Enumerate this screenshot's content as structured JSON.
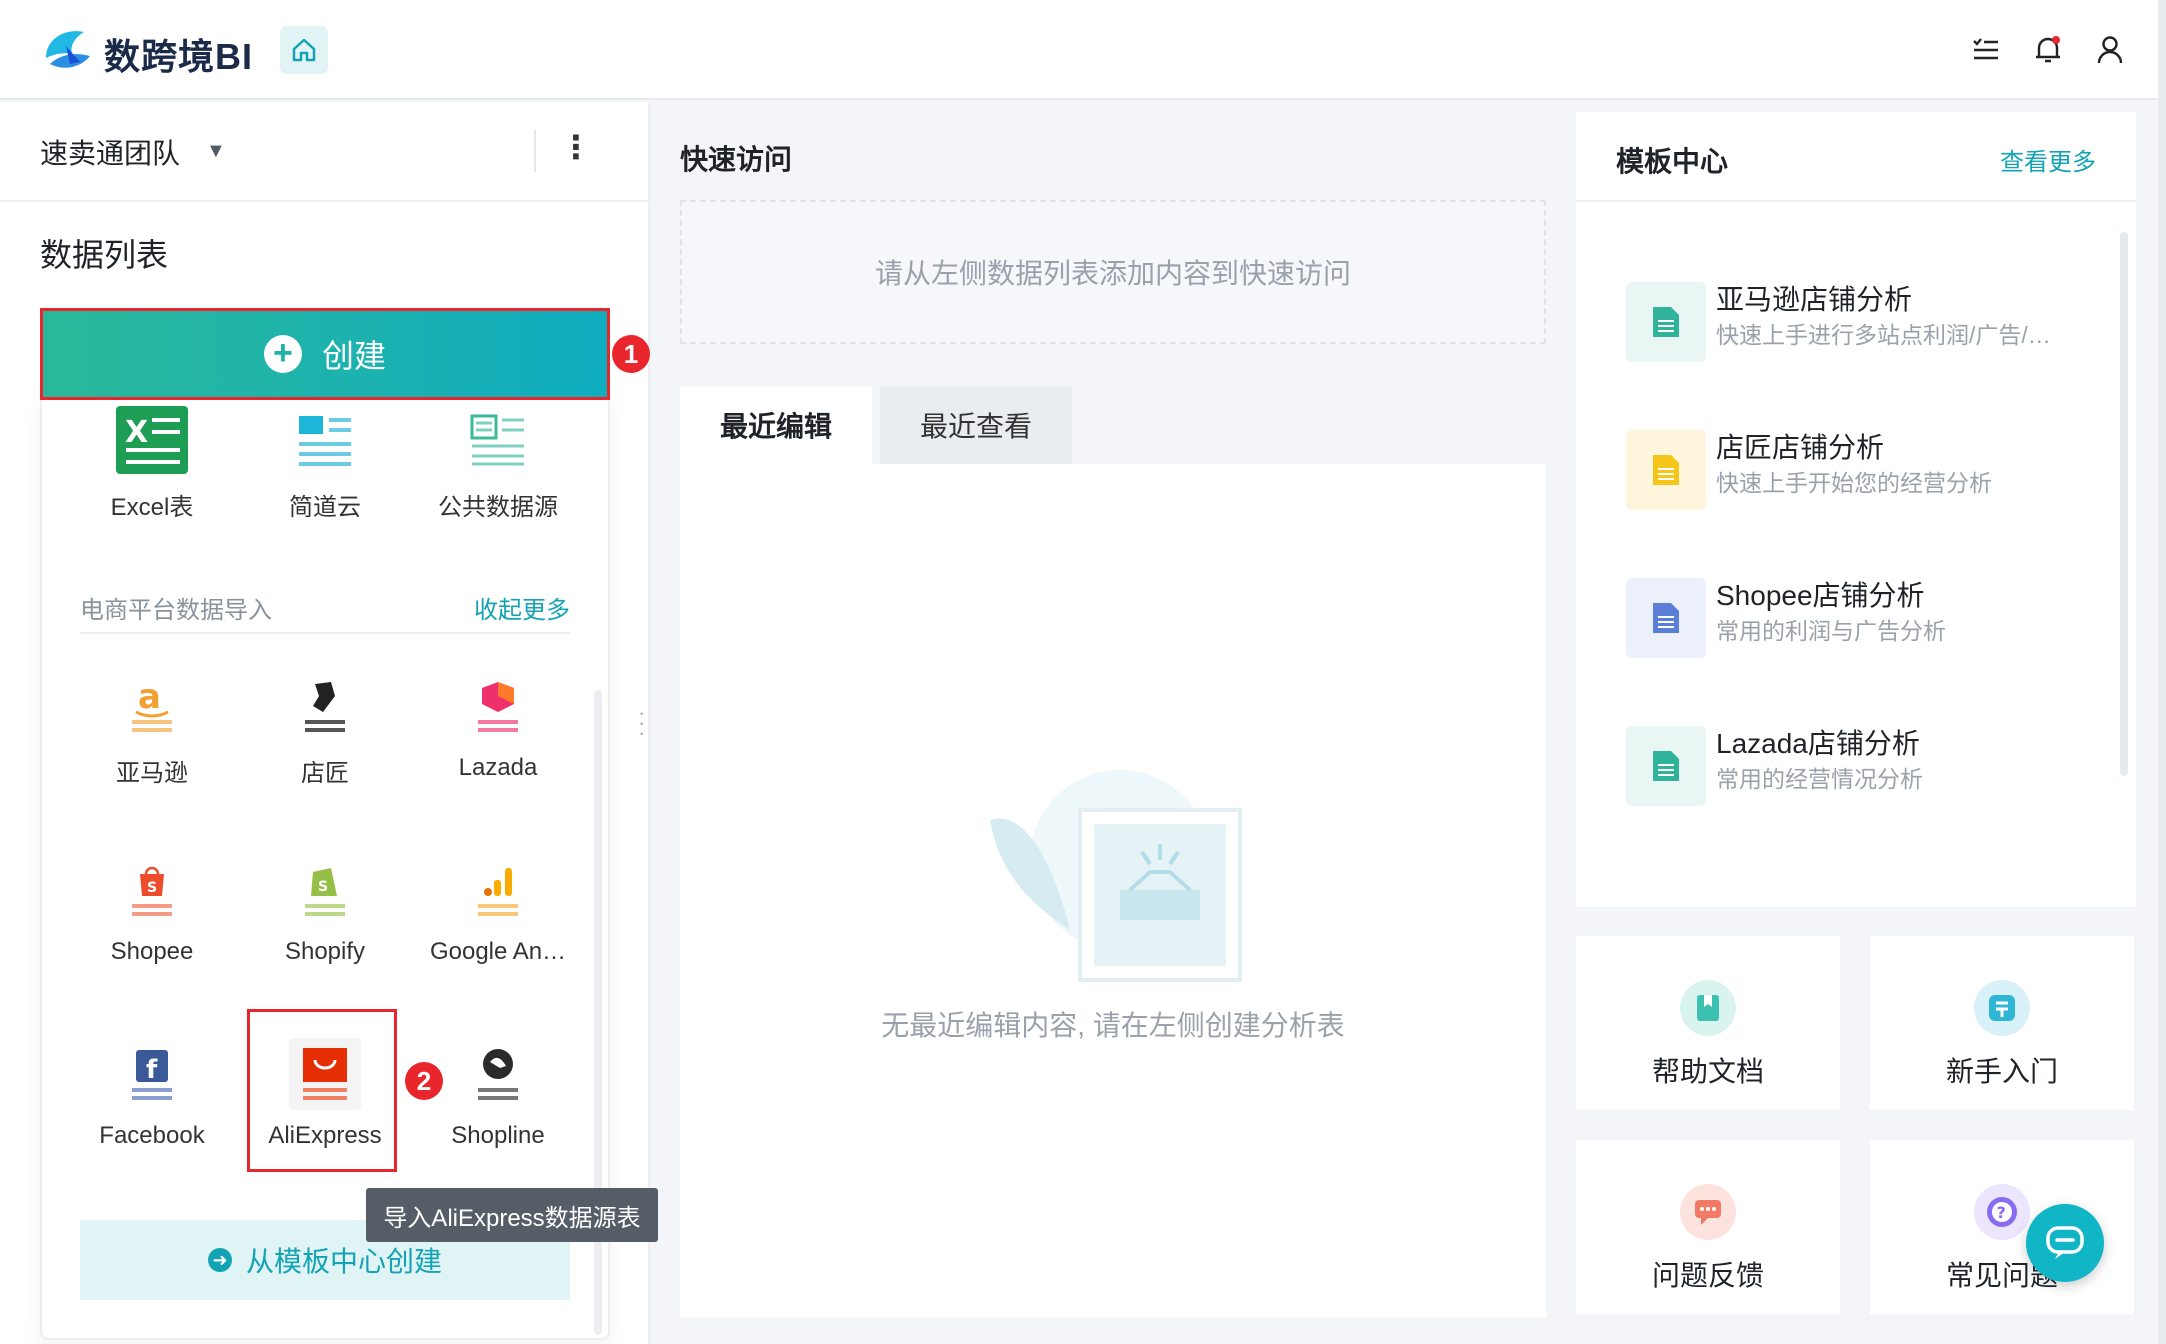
{
  "app": {
    "name": "数跨境BI"
  },
  "sidebar": {
    "team_name": "速卖通团队",
    "data_list_title": "数据列表",
    "create_label": "创建",
    "create_step": "1",
    "sources": [
      {
        "label": "Excel表",
        "icon": "excel-icon"
      },
      {
        "label": "简道云",
        "icon": "jiandaoyun-icon"
      },
      {
        "label": "公共数据源",
        "icon": "public-data-icon"
      }
    ],
    "ecommerce_heading": "电商平台数据导入",
    "collapse_more": "收起更多",
    "platforms": [
      {
        "label": "亚马逊",
        "icon": "amazon-icon"
      },
      {
        "label": "店匠",
        "icon": "shoplazza-icon"
      },
      {
        "label": "Lazada",
        "icon": "lazada-icon"
      },
      {
        "label": "Shopee",
        "icon": "shopee-icon"
      },
      {
        "label": "Shopify",
        "icon": "shopify-icon"
      },
      {
        "label": "Google An…",
        "icon": "google-analytics-icon"
      },
      {
        "label": "Facebook",
        "icon": "facebook-icon"
      },
      {
        "label": "AliExpress",
        "icon": "aliexpress-icon"
      },
      {
        "label": "Shopline",
        "icon": "shopline-icon"
      }
    ],
    "aliexpress_step": "2",
    "tooltip": "导入AliExpress数据源表",
    "from_template": "从模板中心创建"
  },
  "main": {
    "quick_access_title": "快速访问",
    "quick_access_placeholder": "请从左侧数据列表添加内容到快速访问",
    "tabs": [
      {
        "label": "最近编辑",
        "active": true
      },
      {
        "label": "最近查看",
        "active": false
      }
    ],
    "empty_text": "无最近编辑内容, 请在左侧创建分析表"
  },
  "templates": {
    "title": "模板中心",
    "view_more": "查看更多",
    "items": [
      {
        "title": "亚马逊店铺分析",
        "subtitle": "快速上手进行多站点利润/广告/…",
        "color": "#2fb39a"
      },
      {
        "title": "店匠店铺分析",
        "subtitle": "快速上手开始您的经营分析",
        "color": "#f5c518"
      },
      {
        "title": "Shopee店铺分析",
        "subtitle": "常用的利润与广告分析",
        "color": "#5b7fd6"
      },
      {
        "title": "Lazada店铺分析",
        "subtitle": "常用的经营情况分析",
        "color": "#2fb39a"
      }
    ]
  },
  "help_cards": [
    {
      "label": "帮助文档",
      "icon": "bookmark-icon",
      "color": "#3cc0b0"
    },
    {
      "label": "新手入门",
      "icon": "signpost-icon",
      "color": "#2fb6d6"
    },
    {
      "label": "问题反馈",
      "icon": "feedback-icon",
      "color": "#f07a66"
    },
    {
      "label": "常见问题",
      "icon": "question-icon",
      "color": "#8a6cf0"
    }
  ],
  "colors": {
    "accent": "#13a3b4",
    "highlight": "#e8262b"
  }
}
